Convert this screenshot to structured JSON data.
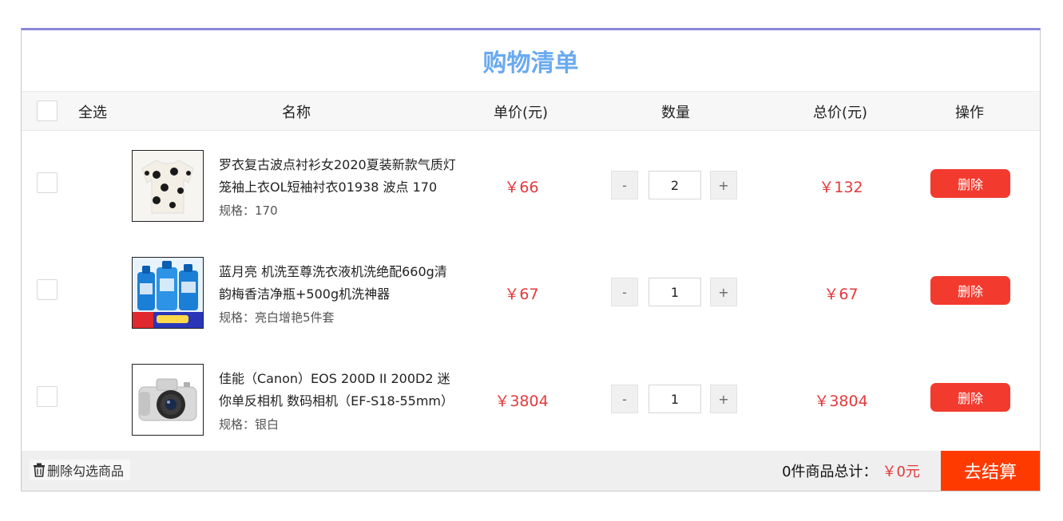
{
  "title": "购物清单",
  "header": {
    "select_all": "全选",
    "name": "名称",
    "unit_price": "单价(元)",
    "quantity": "数量",
    "total_price": "总价(元)",
    "action": "操作"
  },
  "items": [
    {
      "name": "罗衣复古波点衬衫女2020夏装新款气质灯笼袖上衣OL短袖衬衣01938 波点 170",
      "spec_label": "规格：",
      "spec": "170",
      "price": "￥66",
      "qty": "2",
      "total": "￥132",
      "delete": "删除",
      "minus": "-",
      "plus": "+"
    },
    {
      "name": "蓝月亮 机洗至尊洗衣液机洗绝配660g清韵梅香洁净瓶+500g机洗神器",
      "spec_label": "规格：",
      "spec": "亮白增艳5件套",
      "price": "￥67",
      "qty": "1",
      "total": "￥67",
      "delete": "删除",
      "minus": "-",
      "plus": "+"
    },
    {
      "name": "佳能（Canon）EOS 200D II 200D2 迷你单反相机 数码相机（EF-S18-55mm）",
      "spec_label": "规格：",
      "spec": "银白",
      "price": "￥3804",
      "qty": "1",
      "total": "￥3804",
      "delete": "删除",
      "minus": "-",
      "plus": "+"
    }
  ],
  "footer": {
    "delete_selected": "删除勾选商品",
    "count_text": "0件商品总计：",
    "total": "￥0元",
    "checkout": "去结算"
  },
  "colors": {
    "accent_title": "#6aaaf0",
    "price_red": "#e4393c",
    "delete_button": "#f23a2f",
    "checkout_button": "#ff3a00"
  },
  "icons": [
    "trash-icon",
    "blouse-thumbnail",
    "detergent-thumbnail",
    "camera-thumbnail"
  ]
}
